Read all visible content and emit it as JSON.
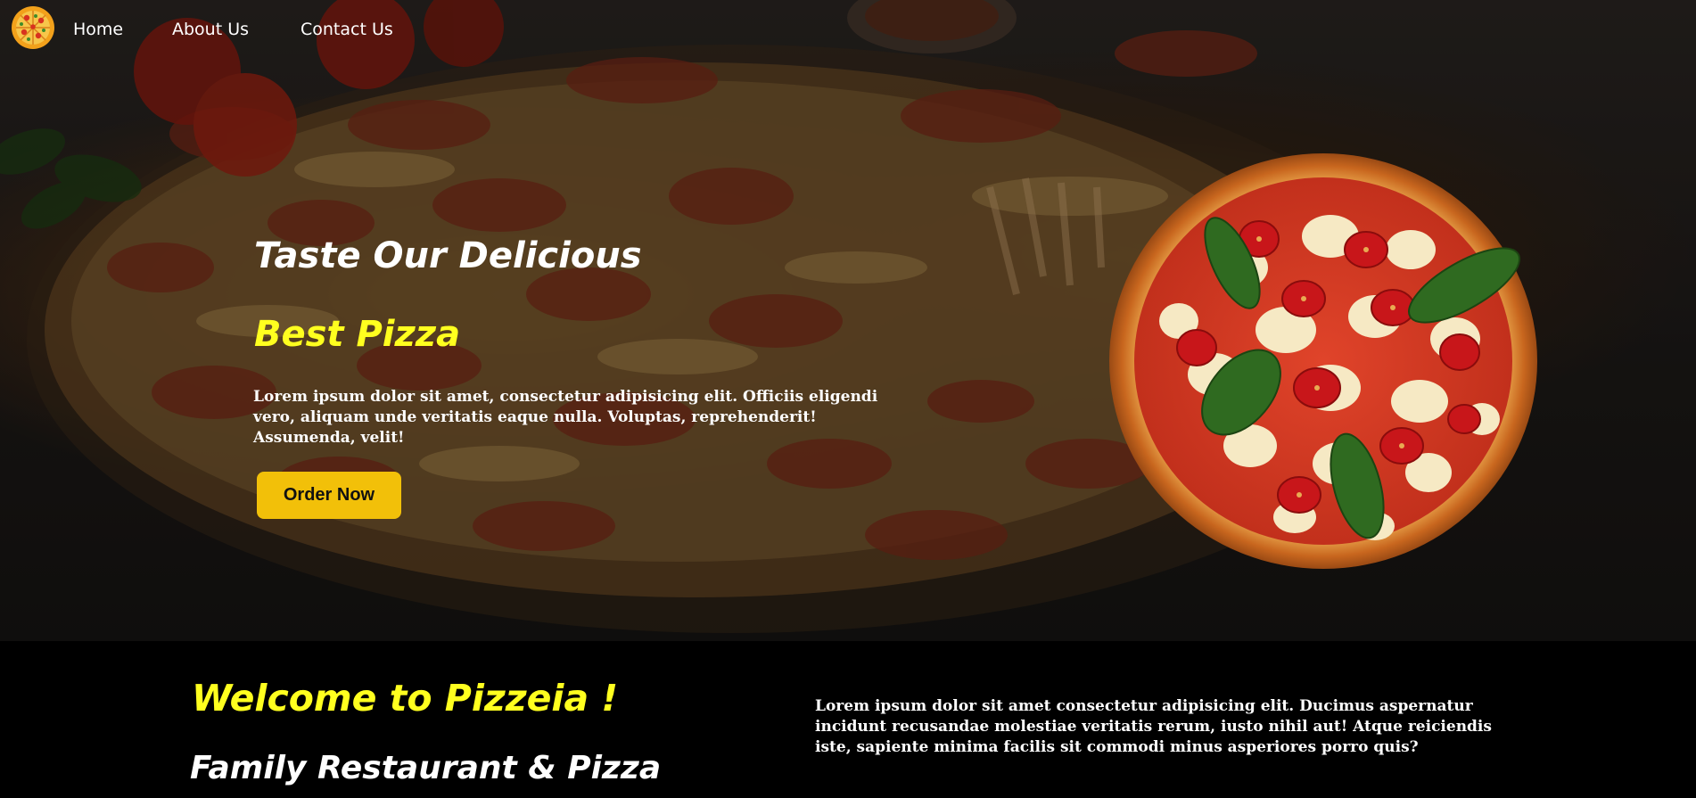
{
  "nav": {
    "logo_icon": "pizza-logo-icon",
    "links": [
      {
        "label": "Home"
      },
      {
        "label": "About Us"
      },
      {
        "label": "Contact Us"
      }
    ]
  },
  "hero": {
    "title": "Taste Our Delicious",
    "subtitle": "Best Pizza",
    "text": "Lorem ipsum dolor sit amet, consectetur adipisicing elit. Officiis eligendi vero, aliquam unde veritatis eaque nulla. Voluptas, reprehenderit! Assumenda, velit!",
    "button_label": "Order Now",
    "image": "pizza-image"
  },
  "welcome": {
    "title": "Welcome to Pizzeia !",
    "subtitle": "Family Restaurant & Pizza",
    "text": "Lorem ipsum dolor sit amet consectetur adipisicing elit. Ducimus aspernatur incidunt recusandae molestiae veritatis rerum, iusto nihil aut! Atque reiciendis iste, sapiente minima facilis sit commodi minus asperiores porro quis?"
  },
  "colors": {
    "accent_yellow": "#ffff1f",
    "button_yellow": "#f2c009",
    "background": "#000000"
  }
}
